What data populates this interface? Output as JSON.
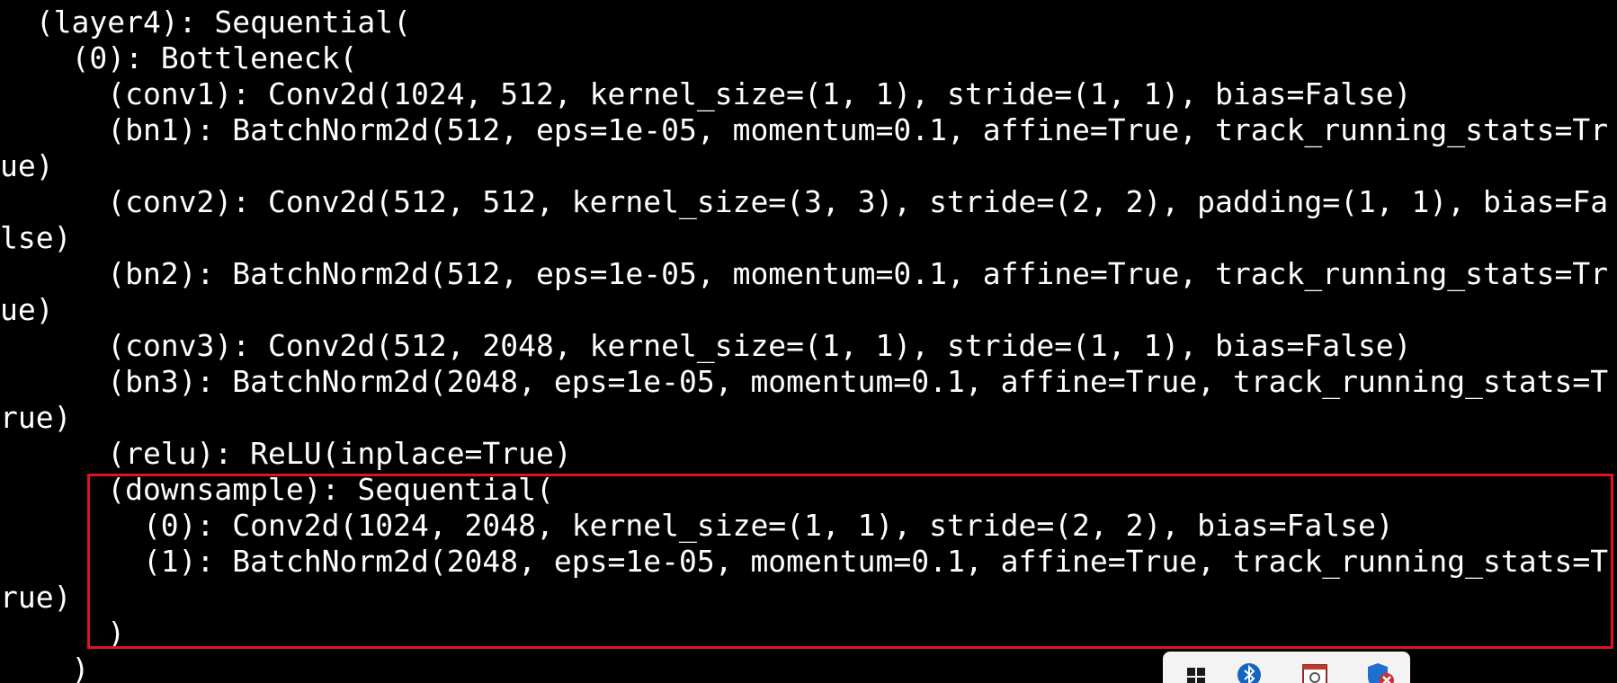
{
  "terminal": {
    "lines": [
      "  (layer4): Sequential(",
      "    (0): Bottleneck(",
      "      (conv1): Conv2d(1024, 512, kernel_size=(1, 1), stride=(1, 1), bias=False)",
      "      (bn1): BatchNorm2d(512, eps=1e-05, momentum=0.1, affine=True, track_running_stats=Tr",
      "ue)",
      "      (conv2): Conv2d(512, 512, kernel_size=(3, 3), stride=(2, 2), padding=(1, 1), bias=Fa",
      "lse)",
      "      (bn2): BatchNorm2d(512, eps=1e-05, momentum=0.1, affine=True, track_running_stats=Tr",
      "ue)",
      "      (conv3): Conv2d(512, 2048, kernel_size=(1, 1), stride=(1, 1), bias=False)",
      "      (bn3): BatchNorm2d(2048, eps=1e-05, momentum=0.1, affine=True, track_running_stats=T",
      "rue)",
      "      (relu): ReLU(inplace=True)",
      "      (downsample): Sequential(",
      "        (0): Conv2d(1024, 2048, kernel_size=(1, 1), stride=(2, 2), bias=False)",
      "        (1): BatchNorm2d(2048, eps=1e-05, momentum=0.1, affine=True, track_running_stats=T",
      "rue)",
      "      )",
      "    )"
    ]
  },
  "annotation": {
    "color": "#e0141e"
  },
  "taskbar_tray": {
    "icons": [
      "windows-start-icon",
      "bluetooth-icon",
      "image-viewer-icon",
      "security-shield-icon"
    ]
  }
}
